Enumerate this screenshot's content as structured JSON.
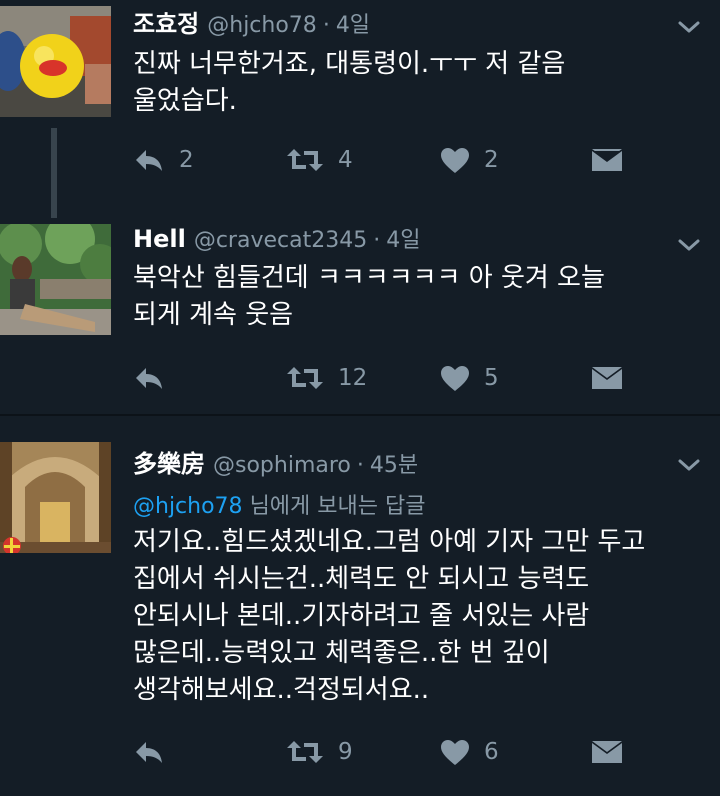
{
  "tweets": [
    {
      "name": "조효정",
      "handle": "@hjcho78",
      "time": "4일",
      "lines": [
        "진짜 너무한거죠, 대통령이.ㅜㅜ 저 같음",
        "울었습다."
      ],
      "reply_count": "2",
      "retweet_count": "4",
      "like_count": "2",
      "avatar": "yellow-ball-photo"
    },
    {
      "name": "Hell",
      "handle": "@cravecat2345",
      "time": "4일",
      "lines": [
        "북악산 힘들건데 ㅋㅋㅋㅋㅋㅋ 아 웃겨 오늘",
        "되게 계속 웃음"
      ],
      "reply_count": "",
      "retweet_count": "12",
      "like_count": "5",
      "avatar": "person-in-garden-photo"
    },
    {
      "name": "多樂房",
      "handle": "@sophimaro",
      "time": "45분",
      "reply_mention": "@hjcho78",
      "reply_suffix": "님에게 보내는 답글",
      "lines": [
        "저기요..힘드셨겠네요.그럼 아예 기자 그만 두고",
        "집에서 쉬시는건..체력도 안 되시고 능력도",
        "안되시나 본데..기자하려고 줄 서있는 사람",
        "많은데..능력있고 체력좋은..한 번 깊이",
        "생각해보세요..걱정되서요.."
      ],
      "reply_count": "",
      "retweet_count": "9",
      "like_count": "6",
      "avatar": "church-interior-photo"
    }
  ],
  "colors": {
    "background": "#141d26",
    "muted": "#8899a6",
    "link": "#1da1f2"
  }
}
